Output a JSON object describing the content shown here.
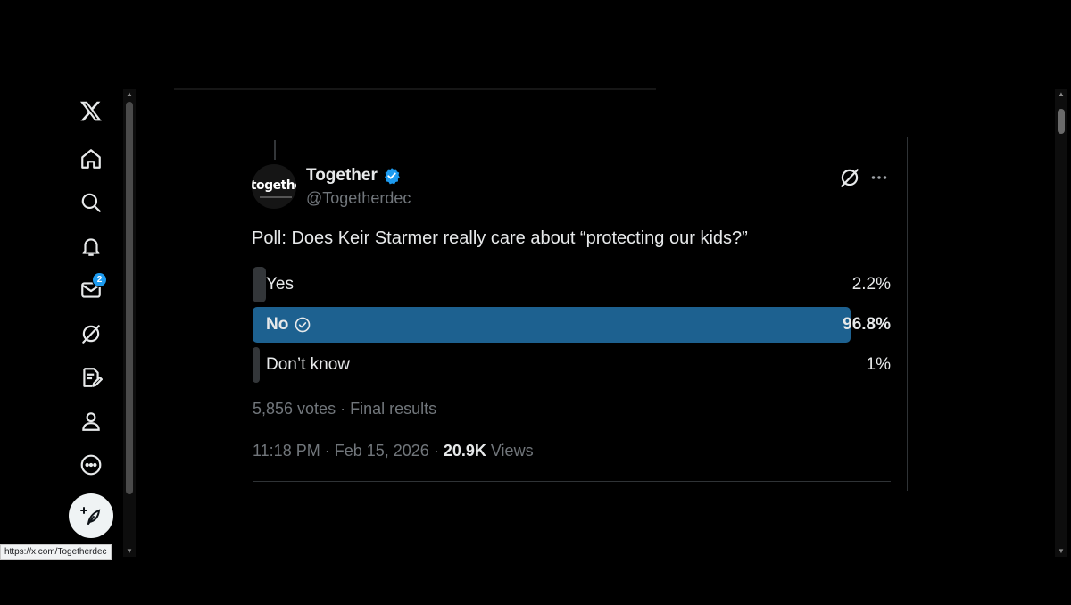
{
  "sidebar": {
    "items": [
      {
        "name": "x-logo-icon"
      },
      {
        "name": "home-icon"
      },
      {
        "name": "search-icon"
      },
      {
        "name": "notifications-icon"
      },
      {
        "name": "messages-icon",
        "badge": "2"
      },
      {
        "name": "grok-icon"
      },
      {
        "name": "lists-icon"
      },
      {
        "name": "profile-icon"
      },
      {
        "name": "more-icon"
      }
    ],
    "compose": {
      "name": "compose-icon"
    }
  },
  "tweet": {
    "avatar_text": "togethe",
    "author_name": "Together",
    "author_handle": "@Togetherdec",
    "text": "Poll: Does Keir Starmer really care about “protecting our kids?”",
    "poll": {
      "options": [
        {
          "label": "Yes",
          "percent": "2.2%",
          "fraction": 0.022,
          "winner": false
        },
        {
          "label": "No",
          "percent": "96.8%",
          "fraction": 0.968,
          "winner": true
        },
        {
          "label": "Don’t know",
          "percent": "1%",
          "fraction": 0.01,
          "winner": false
        }
      ],
      "votes": "5,856 votes",
      "status": "Final results"
    },
    "time": "11:18 PM",
    "date": "Feb 15, 2026",
    "views_count": "20.9K",
    "views_label": "Views"
  },
  "status_bar": {
    "url": "https://x.com/Togetherdec"
  },
  "colors": {
    "accent": "#1d9bf0",
    "winner_bar": "#1d6190",
    "muted": "#71767b"
  }
}
